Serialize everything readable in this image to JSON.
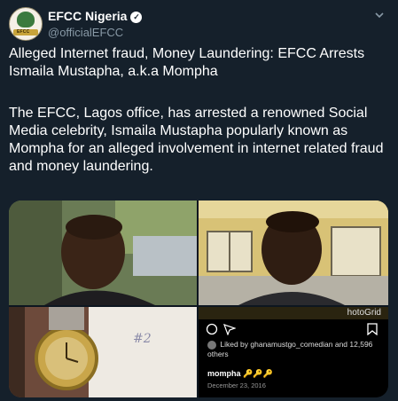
{
  "account": {
    "name": "EFCC Nigeria",
    "verified_mark": "✓",
    "handle": "@officialEFCC",
    "avatar_text": "EFCC"
  },
  "tweet": {
    "line1": "Alleged Internet fraud, Money Laundering: EFCC Arrests Ismaila Mustapha, a.k.a Mompha",
    "line2": "The EFCC, Lagos office, has arrested a renowned Social Media celebrity, Ismaila Mustapha popularly known as Mompha for an alleged involvement in internet related fraud and money laundering."
  },
  "media": {
    "instagram": {
      "photogrid_label": "hotoGrid",
      "liked_by": "Liked by ghanamustgo_comedian and 12,596 others",
      "username": "mompha",
      "emoji": "🔑🔑🔑",
      "date": "December 23, 2016"
    }
  },
  "icons": {
    "chevron": "chevron-down-icon",
    "comment": "comment-icon",
    "share": "share-icon",
    "bookmark": "bookmark-icon"
  },
  "colors": {
    "background": "#15202b",
    "handle": "#8899a6"
  }
}
